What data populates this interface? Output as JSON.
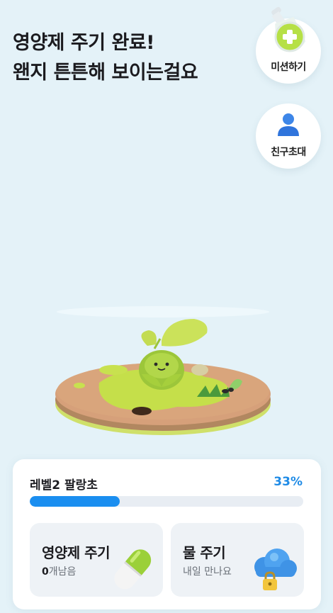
{
  "headline": {
    "line1": "영양제 주기 완료!",
    "line2": "왠지 튼튼해 보이는걸요"
  },
  "side_buttons": {
    "mission": {
      "label": "미션하기",
      "icon": "flask-plus-icon"
    },
    "invite": {
      "label": "친구초대",
      "icon": "person-icon"
    }
  },
  "status": {
    "level_label": "레벨2 팔랑초",
    "percent_label": "33%",
    "progress_fraction": 0.33
  },
  "actions": {
    "feed": {
      "title": "영양제 주기",
      "count": "0",
      "count_suffix": "개남음",
      "icon": "pill-capsule-icon"
    },
    "water": {
      "title": "물 주기",
      "subtitle": "내일 만나요",
      "icon": "cloud-lock-icon"
    }
  },
  "colors": {
    "background": "#e4f2f8",
    "accent": "#1a8ef0",
    "plant_green": "#a7cf3a"
  }
}
